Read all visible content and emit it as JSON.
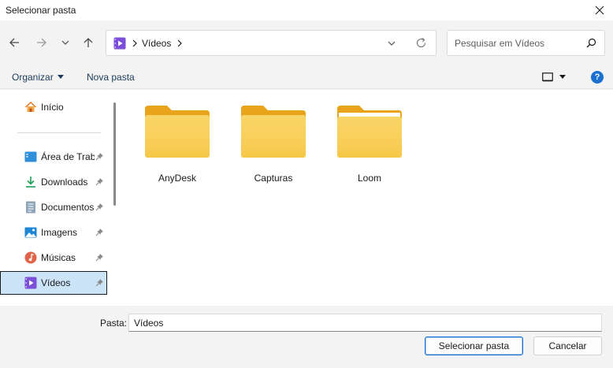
{
  "window": {
    "title": "Selecionar pasta"
  },
  "navigation": {
    "address_crumb": "Vídeos",
    "search_placeholder": "Pesquisar em Vídeos"
  },
  "commands": {
    "organize": "Organizar",
    "new_folder": "Nova pasta",
    "help": "?"
  },
  "sidebar": {
    "home": "Início",
    "items": [
      {
        "label": "Área de Trabalho",
        "icon": "desktop-icon"
      },
      {
        "label": "Downloads",
        "icon": "download-icon"
      },
      {
        "label": "Documentos",
        "icon": "document-icon"
      },
      {
        "label": "Imagens",
        "icon": "image-icon"
      },
      {
        "label": "Músicas",
        "icon": "music-icon"
      },
      {
        "label": "Vídeos",
        "icon": "video-icon",
        "selected": true
      }
    ]
  },
  "folders": [
    {
      "name": "AnyDesk"
    },
    {
      "name": "Capturas"
    },
    {
      "name": "Loom"
    }
  ],
  "footer": {
    "folder_label": "Pasta:",
    "folder_value": "Vídeos",
    "select_button": "Selecionar pasta",
    "cancel_button": "Cancelar"
  },
  "colors": {
    "accent": "#1a6fd1",
    "folder": "#f7c948",
    "video_icon": "#7b4fd8"
  }
}
